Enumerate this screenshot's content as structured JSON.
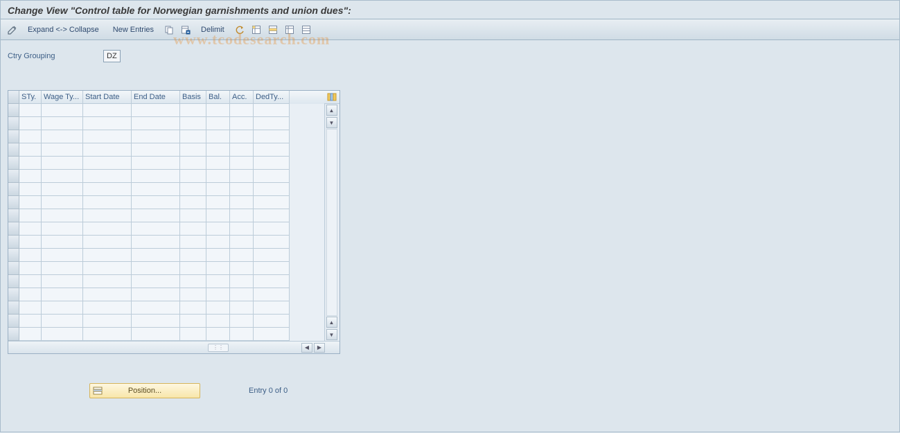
{
  "title": "Change View \"Control table for Norwegian garnishments and union dues\":",
  "toolbar": {
    "expand_collapse": "Expand <-> Collapse",
    "new_entries": "New Entries",
    "delimit": "Delimit"
  },
  "watermark": "www.tcodesearch.com",
  "fields": {
    "ctry_grouping_label": "Ctry Grouping",
    "ctry_grouping_value": "DZ"
  },
  "grid": {
    "columns": {
      "sty": "STy.",
      "wage": "Wage Ty...",
      "start": "Start Date",
      "end": "End Date",
      "basis": "Basis",
      "bal": "Bal.",
      "acc": "Acc.",
      "ded": "DedTy..."
    },
    "row_count_empty": 18
  },
  "footer": {
    "position_label": "Position...",
    "entry_text": "Entry 0 of 0"
  },
  "icons": {
    "pencil": "pencil-icon",
    "copy": "copy-icon",
    "table_del": "table-delete-icon",
    "undo": "undo-icon",
    "select1": "select-all-icon",
    "select2": "select-block-icon",
    "select3": "deselect-icon",
    "config": "configure-columns-icon"
  }
}
